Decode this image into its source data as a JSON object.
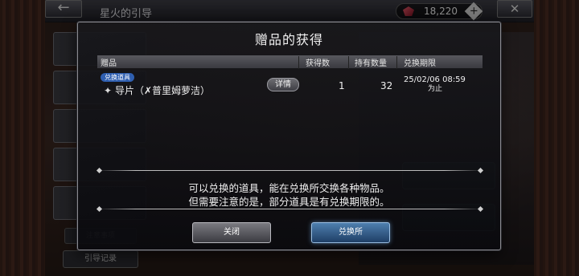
{
  "screen": {
    "title": "星火的引导",
    "back_icon": "←",
    "close_icon": "✕"
  },
  "currency": {
    "amount": "18,220",
    "plus_label": "+"
  },
  "background": {
    "notice_label": "注意事项",
    "record_button": "引导记录"
  },
  "modal": {
    "title": "赠品的获得",
    "columns": [
      "赠品",
      "获得数",
      "持有数量",
      "兑换期限"
    ],
    "item": {
      "badge": "兑换道具",
      "icon": "✦",
      "name": "导片（✗普里姆萝洁）",
      "detail_button": "详情",
      "obtained": "1",
      "owned": "32",
      "deadline": "25/02/06 08:59",
      "deadline_suffix": "为止"
    },
    "message_line1": "可以兑换的道具，能在兑换所交换各种物品。",
    "message_line2": "但需要注意的是，部分道具是有兑换期限的。",
    "close_button": "关闭",
    "exchange_button": "兑换所"
  },
  "colors": {
    "exchange_accent": "#4e7fae",
    "badge_blue": "#2f5fb0",
    "gem_red": "#e35a6a"
  }
}
